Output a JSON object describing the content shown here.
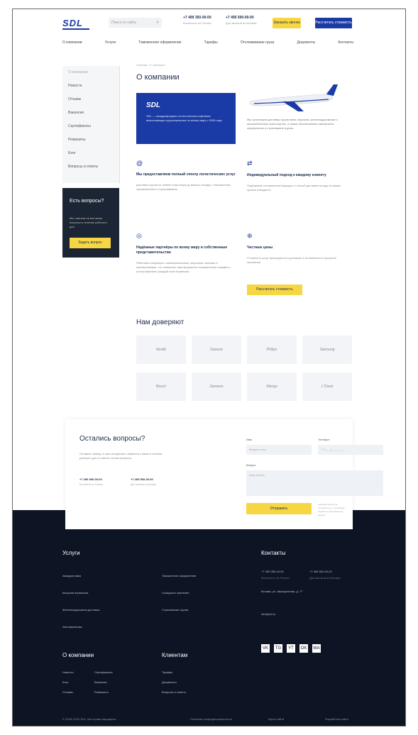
{
  "header": {
    "logo": "SDL",
    "search_placeholder": "Поиск по сайту",
    "phones": [
      {
        "number": "+7 499 350-00-00",
        "caption": "Бесплатно по России"
      },
      {
        "number": "+7 495 500-00-00",
        "caption": "Для звонков из Москвы"
      }
    ],
    "btn_call": "Заказать звонок",
    "btn_calc": "Рассчитать стоимость"
  },
  "nav": [
    "О компании",
    "Услуги",
    "Таможенное оформление",
    "Тарифы",
    "Отслеживание груза",
    "Документы",
    "Контакты"
  ],
  "sidebar": {
    "items": [
      "О компании",
      "Новости",
      "Отзывы",
      "Вакансии",
      "Сертификаты",
      "Реквизиты",
      "Блог",
      "Вопросы и ответы"
    ]
  },
  "question_box": {
    "title": "Есть вопросы?",
    "subtitle": "Мы ответим на все ваши вопросы в течение рабочего дня",
    "button": "Задать вопрос"
  },
  "breadcrumb": "Главная / О компании",
  "main": {
    "title": "О компании",
    "blue_card": {
      "logo": "SDL",
      "text": "SDL — международная логистическая компания, выполняющая грузоперевозки по всему миру с 2008 года"
    },
    "intro_text": "Мы организуем доставку грузов авиа, морским, железнодорожным и автомобильным транспортом, а также обеспечиваем таможенное оформление и страхование грузов.",
    "features": [
      {
        "icon": "@",
        "title": "Мы предоставляем полный спектр логистических услуг",
        "text": "Доставка грузов из любой точки мира до вашего склада с таможенным оформлением и страхованием."
      },
      {
        "icon": "⇄",
        "title": "Индивидуальный подход к каждому клиенту",
        "text": "Подбираем оптимальный маршрут и способ доставки исходя из ваших сроков и бюджета."
      },
      {
        "icon": "◎",
        "title": "Надёжные партнёры по всему миру и собственные представительства",
        "text": "Работаем напрямую с авиакомпаниями, морскими линиями и перевозчиками, что позволяет нам предлагать конкурентные тарифы и контролировать каждый этап перевозки."
      },
      {
        "icon": "⊕",
        "title": "Честные цены",
        "text": "Стоимость услуг фиксируется в договоре и не меняется в процессе перевозки."
      }
    ],
    "yellow_button": "Рассчитать стоимость",
    "partners_title": "Нам доверяют",
    "partners": [
      "Nestlé",
      "Danone",
      "Philips",
      "Samsung",
      "Bosch",
      "Siemens",
      "Mango",
      "L'Oreal"
    ]
  },
  "contact_form": {
    "title": "Остались вопросы?",
    "text": "Оставьте заявку, и наш специалист свяжется с вами в течение рабочего дня и ответит на все вопросы.",
    "phones": [
      {
        "number": "+7 499 350-00-00",
        "caption": "Бесплатно по России"
      },
      {
        "number": "+7 495 500-00-00",
        "caption": "Для звонков из Москвы"
      }
    ],
    "labels": {
      "name": "Имя",
      "phone": "Телефон",
      "message": "Вопрос"
    },
    "placeholders": {
      "name": "Введите имя",
      "phone": "+7 (___) ___-__-__",
      "message": "Ваш вопрос"
    },
    "submit": "Отправить",
    "agree": "Нажимая кнопку, вы соглашаетесь с условиями обработки персональных данных"
  },
  "footer": {
    "services_title": "Услуги",
    "services": [
      "Авиадоставка",
      "Морская перевозка",
      "Железнодорожная доставка",
      "Автоперевозки",
      "Таможенное оформление",
      "Складское хранение",
      "Страхование грузов"
    ],
    "company_title": "О компании",
    "company_links": [
      "Новости",
      "Блог",
      "Отзывы",
      "Сертификаты",
      "Вакансии",
      "Реквизиты"
    ],
    "clients_title": "Клиентам",
    "clients_links": [
      "Тарифы",
      "Документы",
      "Вопросы и ответы"
    ],
    "contacts_title": "Контакты",
    "contacts_phones": [
      {
        "number": "+7 499 350-00-00",
        "caption": "Бесплатно по России"
      },
      {
        "number": "+7 495 500-00-00",
        "caption": "Для звонков из Москвы"
      }
    ],
    "address": "Москва, ул. Авиационная, д. 77",
    "email": "info@sdl.ru",
    "social": [
      "VK",
      "TG",
      "YT",
      "OK",
      "WA"
    ],
    "copyright": "© 2008–2023 SDL. Все права защищены.",
    "policy": "Политика конфиденциальности",
    "sitemap": "Карта сайта",
    "dev": "Разработка сайта"
  }
}
